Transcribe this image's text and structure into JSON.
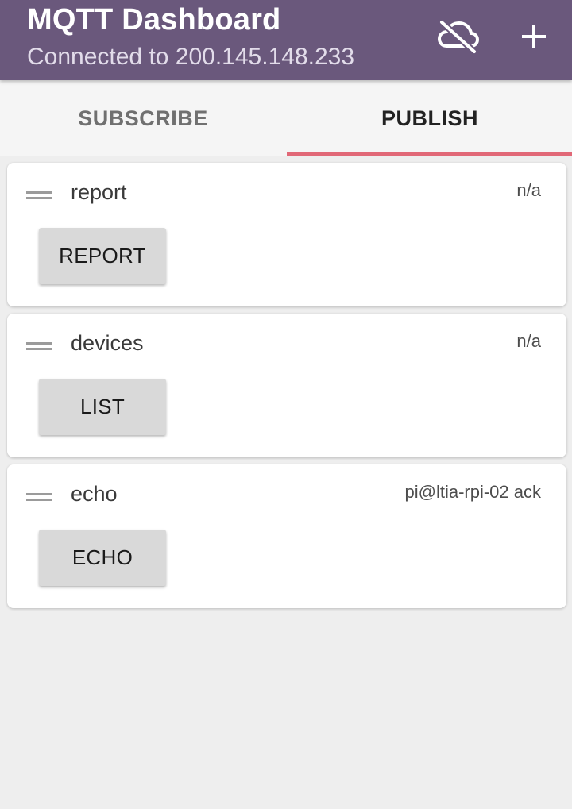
{
  "appbar": {
    "title": "MQTT Dashboard",
    "subtitle": "Connected to 200.145.148.233",
    "background_color": "#6a587c",
    "actions": [
      {
        "icon": "cloud-off-icon"
      },
      {
        "icon": "add-icon"
      }
    ]
  },
  "tabs": [
    {
      "label": "SUBSCRIBE",
      "selected": false
    },
    {
      "label": "PUBLISH",
      "selected": true
    }
  ],
  "tab_indicator_color": "#e16877",
  "cards": [
    {
      "title": "report",
      "status": "n/a",
      "button_label": "REPORT"
    },
    {
      "title": "devices",
      "status": "n/a",
      "button_label": "LIST"
    },
    {
      "title": "echo",
      "status": "pi@ltia-rpi-02 ack",
      "button_label": "ECHO"
    }
  ]
}
